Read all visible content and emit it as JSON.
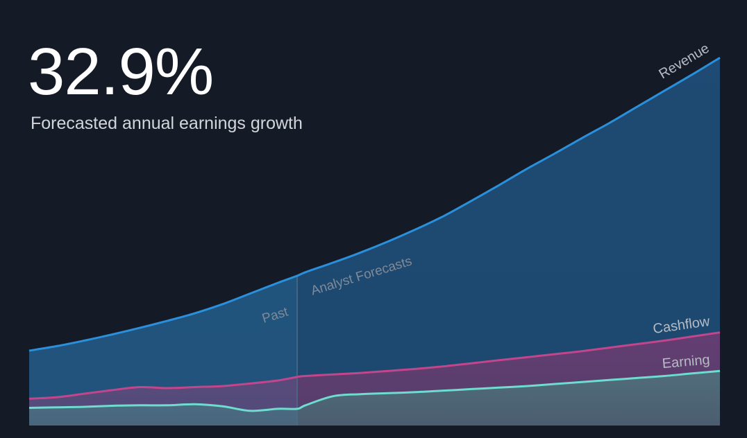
{
  "header": {
    "headline_value": "32.9%",
    "subtitle": "Forecasted annual earnings growth"
  },
  "colors": {
    "background": "#151b26",
    "revenue": "#2b90dc",
    "cashflow": "#c3468c",
    "earning": "#6fdcd0"
  },
  "chart_data": {
    "type": "area",
    "x": [
      0,
      0.04,
      0.08,
      0.12,
      0.16,
      0.2,
      0.24,
      0.28,
      0.32,
      0.36,
      0.388,
      0.4,
      0.44,
      0.48,
      0.52,
      0.56,
      0.6,
      0.64,
      0.68,
      0.72,
      0.76,
      0.8,
      0.84,
      0.88,
      0.92,
      0.96,
      1
    ],
    "periods": {
      "split_x": 0.388,
      "past_label": "Past",
      "forecast_label": "Analyst Forecasts"
    },
    "series": [
      {
        "name": "Revenue",
        "values": [
          148,
          157,
          168,
          180,
          193,
          207,
          222,
          240,
          261,
          282,
          296,
          303,
          322,
          342,
          364,
          388,
          414,
          444,
          475,
          507,
          537,
          568,
          598,
          630,
          662,
          694,
          727
        ]
      },
      {
        "name": "Cashflow",
        "values": [
          53,
          56,
          63,
          70,
          76,
          74,
          76,
          78,
          83,
          89,
          96,
          98,
          101,
          104,
          108,
          112,
          117,
          123,
          129,
          135,
          141,
          147,
          154,
          161,
          168,
          176,
          184
        ]
      },
      {
        "name": "Earning",
        "values": [
          35,
          36,
          37,
          39,
          40,
          40,
          42,
          38,
          29,
          33,
          33,
          40,
          58,
          62,
          64,
          66,
          69,
          72,
          75,
          78,
          82,
          86,
          90,
          94,
          98,
          103,
          108
        ]
      }
    ],
    "ylim": [
      0,
      800
    ],
    "grid": false,
    "legend": "inline labels at right end of each series"
  }
}
